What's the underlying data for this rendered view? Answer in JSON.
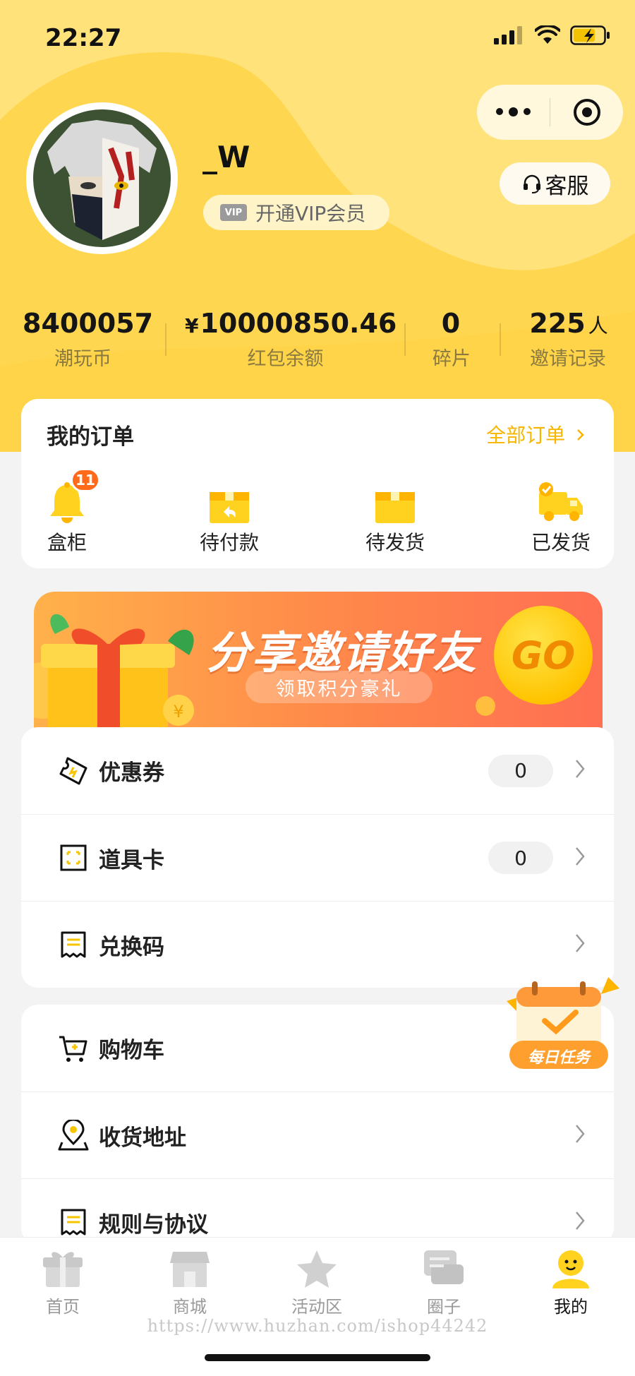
{
  "status_bar": {
    "time": "22:27"
  },
  "header": {
    "service_label": "客服",
    "username": "_W",
    "vip_tag": "VIP",
    "vip_label": "开通VIP会员"
  },
  "stats": [
    {
      "prefix": "",
      "value": "8400057",
      "suffix": "",
      "label": "潮玩币"
    },
    {
      "prefix": "¥",
      "value": "10000850.46",
      "suffix": "",
      "label": "红包余额"
    },
    {
      "prefix": "",
      "value": "0",
      "suffix": "",
      "label": "碎片"
    },
    {
      "prefix": "",
      "value": "225",
      "suffix": "人",
      "label": "邀请记录"
    }
  ],
  "orders": {
    "title": "我的订单",
    "all_label": "全部订单",
    "items": [
      {
        "label": "盒柜",
        "badge": "11",
        "icon": "bell-icon"
      },
      {
        "label": "待付款",
        "badge": "",
        "icon": "box-return-icon"
      },
      {
        "label": "待发货",
        "badge": "",
        "icon": "box-icon"
      },
      {
        "label": "已发货",
        "badge": "",
        "icon": "truck-icon"
      }
    ]
  },
  "banner": {
    "title": "分享邀请好友",
    "subtitle": "领取积分豪礼",
    "go_label": "GO"
  },
  "menu_group1": [
    {
      "label": "优惠券",
      "count": "0",
      "icon": "coupon-icon"
    },
    {
      "label": "道具卡",
      "count": "0",
      "icon": "prop-card-icon"
    },
    {
      "label": "兑换码",
      "count": "",
      "icon": "receipt-icon"
    }
  ],
  "menu_group2": [
    {
      "label": "购物车",
      "icon": "cart-icon"
    },
    {
      "label": "收货地址",
      "icon": "location-icon"
    },
    {
      "label": "规则与协议",
      "icon": "document-icon"
    }
  ],
  "daily_task": {
    "label": "每日任务"
  },
  "tabs": [
    {
      "label": "首页",
      "icon": "gift-icon",
      "active": false
    },
    {
      "label": "商城",
      "icon": "store-icon",
      "active": false
    },
    {
      "label": "活动区",
      "icon": "star-icon",
      "active": false
    },
    {
      "label": "圈子",
      "icon": "chat-icon",
      "active": false
    },
    {
      "label": "我的",
      "icon": "user-icon",
      "active": true
    }
  ],
  "watermark": "https://www.huzhan.com/ishop44242",
  "colors": {
    "brand_yellow": "#ffd64f",
    "accent_orange": "#f7b500",
    "badge_red": "#ff6a1a"
  }
}
